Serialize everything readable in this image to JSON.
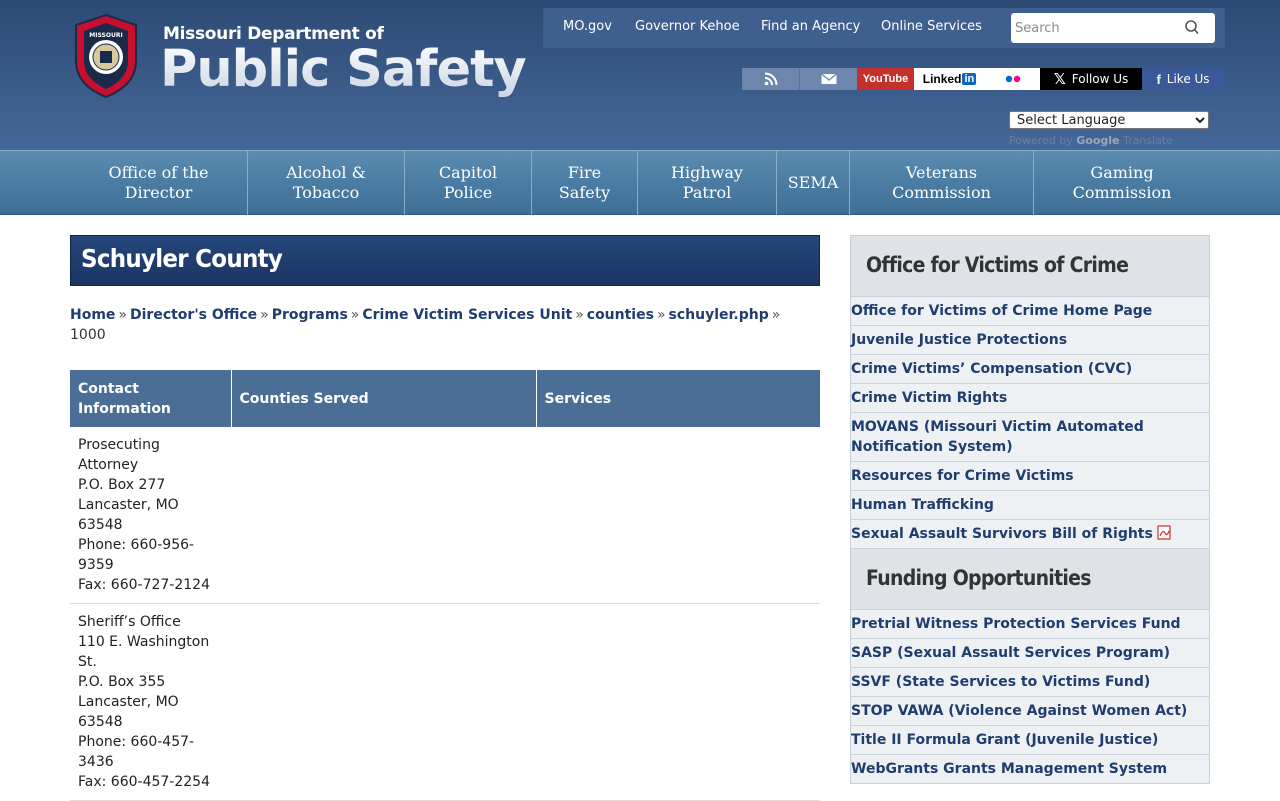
{
  "header": {
    "logo_top": "Missouri Department of",
    "logo_main": "Public Safety",
    "seal_alt": "Missouri Department of Public Safety seal"
  },
  "utility_links": [
    "MO.gov",
    "Governor Kehoe",
    "Find an Agency",
    "Online Services"
  ],
  "search": {
    "placeholder": "Search"
  },
  "social": {
    "youtube": "YouTube",
    "linkedin": "Linked",
    "linkedin_in": "in",
    "x": "Follow Us",
    "facebook": "Like Us"
  },
  "language": {
    "selected": "Select Language",
    "powered": "Powered by",
    "google": "Google",
    "translate": "Translate"
  },
  "nav": [
    [
      "Office of the",
      "Director"
    ],
    [
      "Alcohol &",
      "Tobacco"
    ],
    [
      "Capitol",
      "Police"
    ],
    [
      "Fire",
      "Safety"
    ],
    [
      "Highway",
      "Patrol"
    ],
    [
      "SEMA"
    ],
    [
      "Veterans",
      "Commission"
    ],
    [
      "Gaming",
      "Commission"
    ]
  ],
  "page": {
    "title": "Schuyler County",
    "breadcrumb": [
      "Home",
      "Director's Office",
      "Programs",
      "Crime Victim Services Unit",
      "counties",
      "schuyler.php"
    ],
    "breadcrumb_tail": "1000"
  },
  "table": {
    "headers": [
      "Contact Information",
      "Counties Served",
      "Services"
    ],
    "rows": [
      {
        "contact": [
          "Prosecuting Attorney",
          "P.O. Box 277",
          "Lancaster, MO 63548",
          "Phone: 660-956-9359",
          "Fax: 660-727-2124"
        ],
        "counties": "",
        "services": ""
      },
      {
        "contact": [
          "Sheriff’s Office",
          "110 E. Washington St.",
          "P.O. Box 355",
          "Lancaster, MO 63548",
          "Phone: 660-457-3436",
          "Fax: 660-457-2254"
        ],
        "counties": "",
        "services": ""
      }
    ]
  },
  "sidebar": {
    "sections": [
      {
        "title": "Office for Victims of Crime",
        "links": [
          "Office for Victims of Crime Home Page",
          "Juvenile Justice Protections",
          "Crime Victims’ Compensation (CVC)",
          "Crime Victim Rights",
          "MOVANS (Missouri Victim Automated Notification System)",
          "Resources for Crime Victims",
          "Human Trafficking",
          "Sexual Assault Survivors Bill of Rights"
        ]
      },
      {
        "title": "Funding Opportunities",
        "links": [
          "Pretrial Witness Protection Services Fund",
          "SASP (Sexual Assault Services Program)",
          "SSVF (State Services to Victims Fund)",
          "STOP VAWA (Violence Against Women Act)",
          "Title II Formula Grant (Juvenile Justice)",
          "WebGrants Grants Management System"
        ]
      }
    ]
  }
}
